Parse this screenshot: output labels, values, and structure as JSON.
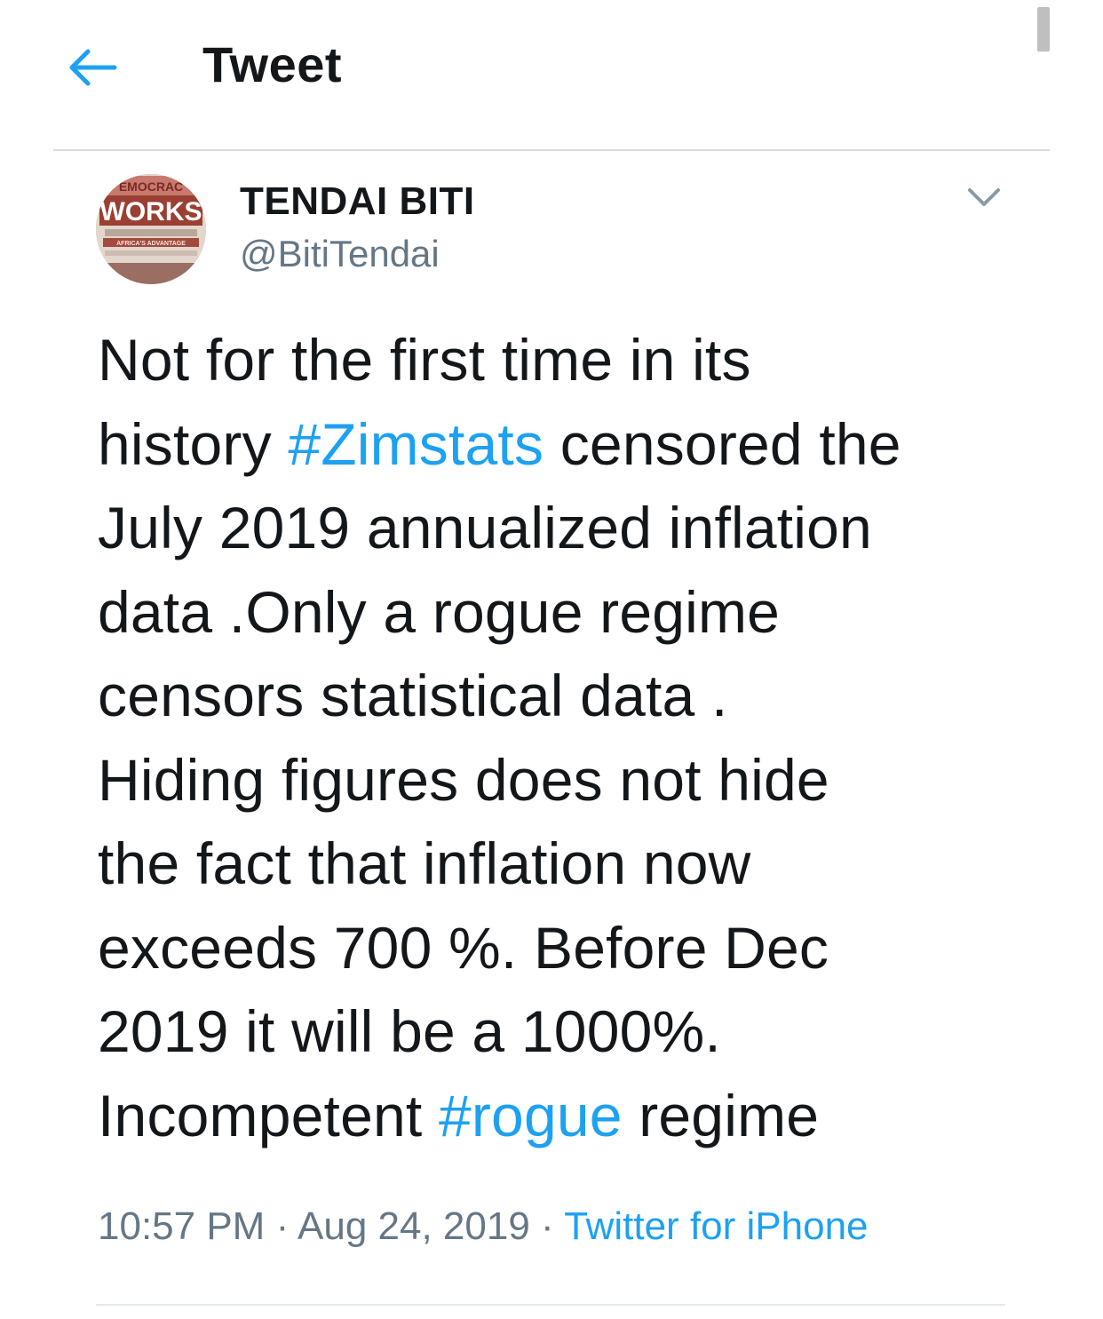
{
  "header": {
    "title": "Tweet",
    "back_icon": "arrow-left-icon",
    "accent_color": "#1da1f2"
  },
  "author": {
    "display_name": "TENDAI BITI",
    "handle": "@BitiTendai",
    "avatar_text": {
      "top": "EMOCRAC",
      "main": "WORKS",
      "small": "AFRICA'S ADVANTAGE"
    },
    "menu_icon": "chevron-down-icon"
  },
  "tweet": {
    "lines": [
      [
        {
          "t": "Not for the first time in its"
        }
      ],
      [
        {
          "t": "history "
        },
        {
          "t": "#Zimstats",
          "tag": true
        },
        {
          "t": " censored the"
        }
      ],
      [
        {
          "t": "July 2019 annualized inflation"
        }
      ],
      [
        {
          "t": "data .Only a rogue regime"
        }
      ],
      [
        {
          "t": "censors statistical data ."
        }
      ],
      [
        {
          "t": "Hiding figures does not hide"
        }
      ],
      [
        {
          "t": "the fact that inflation now"
        }
      ],
      [
        {
          "t": "exceeds 700 %. Before Dec"
        }
      ],
      [
        {
          "t": "2019 it will be a 1000%."
        }
      ],
      [
        {
          "t": "Incompetent "
        },
        {
          "t": "#rogue",
          "tag": true
        },
        {
          "t": " regime"
        }
      ]
    ]
  },
  "meta": {
    "time": "10:57 PM",
    "separator": " · ",
    "date": "Aug 24, 2019",
    "source": "Twitter for iPhone"
  },
  "colors": {
    "text": "#14171a",
    "secondary": "#657786",
    "link": "#1da1f2",
    "divider": "#e1e8ed"
  }
}
